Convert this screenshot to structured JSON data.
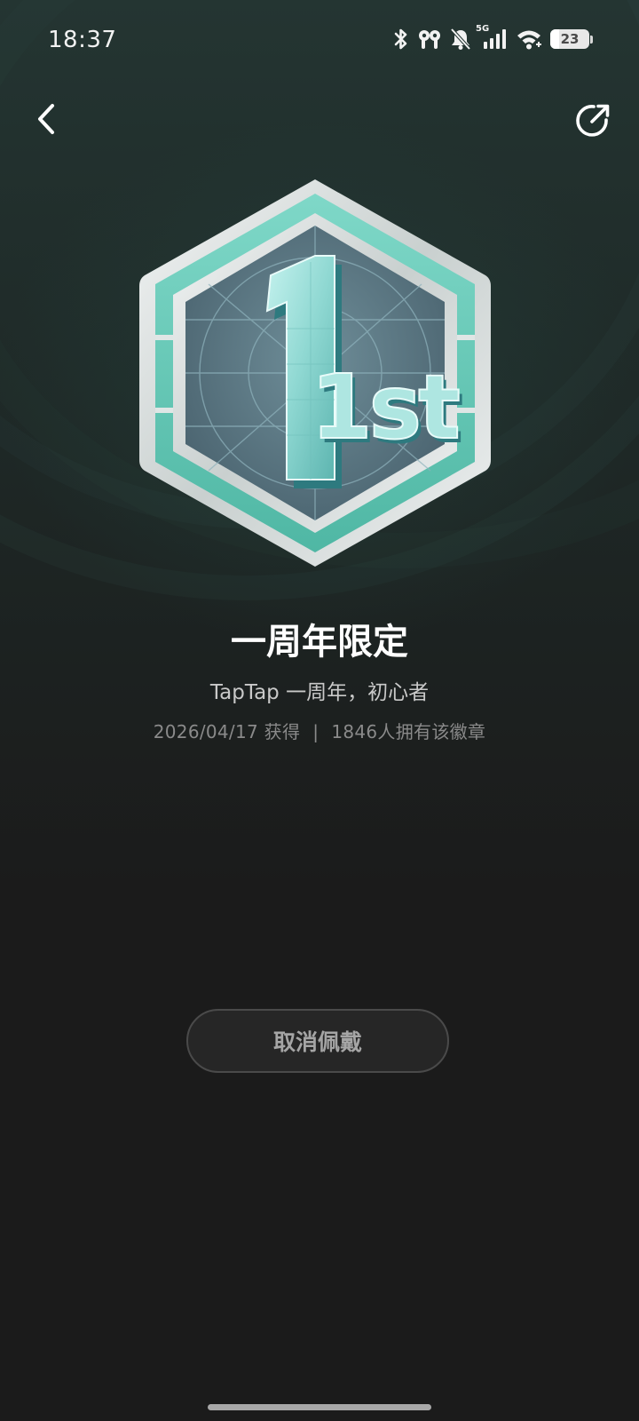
{
  "status_bar": {
    "time": "18:37",
    "network_label": "5G",
    "battery_level": "23",
    "icons": [
      "bluetooth-icon",
      "earbuds-icon",
      "bell-muted-icon",
      "signal-icon",
      "wifi-icon",
      "battery-icon"
    ]
  },
  "header": {
    "back_icon": "chevron-left-icon",
    "share_icon": "share-icon"
  },
  "badge": {
    "emblem_text": "1st",
    "title": "一周年限定",
    "subtitle": "TapTap 一周年，初心者",
    "obtained_text": "2026/04/17 获得",
    "separator": "|",
    "owners_text": "1846人拥有该徽章",
    "colors": {
      "frame": "#d9dfde",
      "teal": "#5fc6b3",
      "inner": "#5d7a86",
      "numeral": "#9fe2dd"
    }
  },
  "actions": {
    "unequip_label": "取消佩戴"
  }
}
